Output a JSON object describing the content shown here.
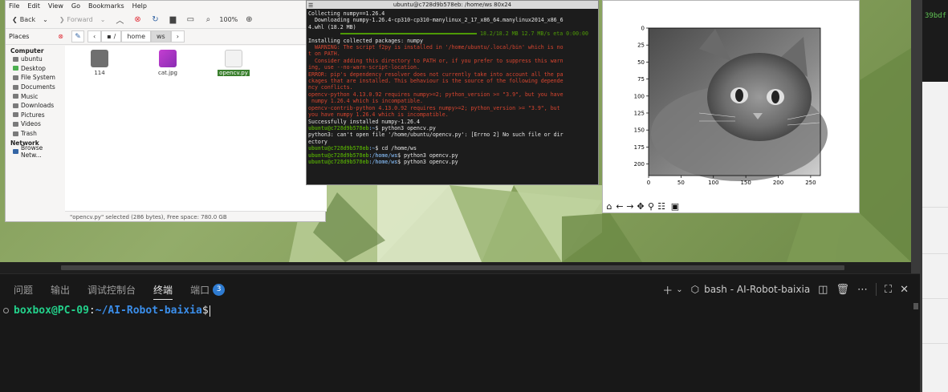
{
  "file_manager": {
    "menu": [
      "File",
      "Edit",
      "View",
      "Go",
      "Bookmarks",
      "Help"
    ],
    "toolbar": {
      "back": "Back",
      "forward": "Forward",
      "zoom": "100%"
    },
    "places_label": "Places",
    "path": [
      "/",
      "home",
      "ws"
    ],
    "sidebar": {
      "computer_label": "Computer",
      "computer_items": [
        "ubuntu",
        "Desktop",
        "File System",
        "Documents",
        "Music",
        "Downloads",
        "Pictures",
        "Videos",
        "Trash"
      ],
      "network_label": "Network",
      "network_items": [
        "Browse Netw..."
      ]
    },
    "files": [
      {
        "name": "114",
        "kind": "folder"
      },
      {
        "name": "cat.jpg",
        "kind": "image"
      },
      {
        "name": "opencv.py",
        "kind": "text",
        "selected": true
      }
    ],
    "status": "\"opencv.py\" selected (286 bytes), Free space: 780.0 GB"
  },
  "terminal": {
    "title": "ubuntu@c728d9b578eb: /home/ws 80x24",
    "lines": [
      {
        "c": "w",
        "t": "Collecting numpy==1.26.4"
      },
      {
        "c": "w",
        "t": "  Downloading numpy-1.26.4-cp310-cp310-manylinux_2_17_x86_64.manylinux2014_x86_6"
      },
      {
        "c": "w",
        "t": "4.whl (18.2 MB)"
      },
      {
        "c": "g",
        "t": "                                                    18.2/18.2 MB 12.7 MB/s eta 0:00:00",
        "bar": true
      },
      {
        "c": "w",
        "t": "Installing collected packages: numpy"
      },
      {
        "c": "r",
        "t": "  WARNING: The script f2py is installed in '/home/ubuntu/.local/bin' which is no"
      },
      {
        "c": "r",
        "t": "t on PATH."
      },
      {
        "c": "r",
        "t": "  Consider adding this directory to PATH or, if you prefer to suppress this warn"
      },
      {
        "c": "r",
        "t": "ing, use --no-warn-script-location."
      },
      {
        "c": "r",
        "t": "ERROR: pip's dependency resolver does not currently take into account all the pa"
      },
      {
        "c": "r",
        "t": "ckages that are installed. This behaviour is the source of the following depende"
      },
      {
        "c": "r",
        "t": "ncy conflicts."
      },
      {
        "c": "r",
        "t": "opencv-python 4.13.0.92 requires numpy>=2; python_version >= \"3.9\", but you have"
      },
      {
        "c": "r",
        "t": " numpy 1.26.4 which is incompatible."
      },
      {
        "c": "r",
        "t": "opencv-contrib-python 4.13.0.92 requires numpy>=2; python_version >= \"3.9\", but"
      },
      {
        "c": "r",
        "t": "you have numpy 1.26.4 which is incompatible."
      },
      {
        "c": "w",
        "t": "Successfully installed numpy-1.26.4"
      },
      {
        "prompt": true,
        "user": "ubuntu@c728d9b578eb",
        "path": ":~",
        "cmd": "$ python3 opencv.py"
      },
      {
        "c": "w",
        "t": "python3: can't open file '/home/ubuntu/opencv.py': [Errno 2] No such file or dir"
      },
      {
        "c": "w",
        "t": "ectory"
      },
      {
        "prompt": true,
        "user": "ubuntu@c728d9b578eb",
        "path": ":~",
        "cmd": "$ cd /home/ws"
      },
      {
        "prompt": true,
        "user": "ubuntu@c728d9b578eb",
        "path": ":/home/ws",
        "cmd": "$ python3 opencv.py"
      },
      {
        "prompt": true,
        "user": "ubuntu@c728d9b578eb",
        "path": ":/home/ws",
        "cmd": "$ python3 opencv.py"
      }
    ]
  },
  "figure": {
    "x_ticks": [
      "0",
      "50",
      "100",
      "150",
      "200",
      "250"
    ],
    "y_ticks": [
      "0",
      "25",
      "50",
      "75",
      "100",
      "125",
      "150",
      "175",
      "200"
    ],
    "xlim": [
      0,
      265
    ],
    "ylim": [
      0,
      217
    ],
    "toolbar_icons": [
      "home-icon",
      "back-arrow-icon",
      "forward-arrow-icon",
      "pan-icon",
      "zoom-icon",
      "configure-icon",
      "save-icon"
    ]
  },
  "right_window": {
    "partial_text": "39bdf"
  },
  "vscode_panel": {
    "tabs": [
      {
        "label": "问题",
        "active": false
      },
      {
        "label": "输出",
        "active": false
      },
      {
        "label": "调试控制台",
        "active": false
      },
      {
        "label": "终端",
        "active": true
      },
      {
        "label": "端口",
        "active": false,
        "badge": "3"
      }
    ],
    "terminal_name": "bash - AI-Robot-baixia",
    "prompt": {
      "user": "boxbox@PC-09",
      "colon": ":",
      "path": "~/AI-Robot-baixia",
      "dollar": "$"
    }
  }
}
